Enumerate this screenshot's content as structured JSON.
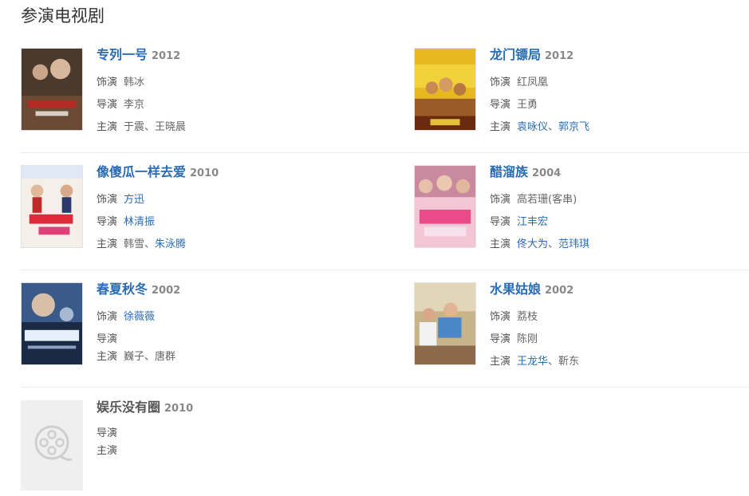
{
  "section_title": "参演电视剧",
  "labels": {
    "role": "饰演",
    "director": "导演",
    "cast": "主演",
    "sep": "、"
  },
  "colors": {
    "link": "#2a6cb4",
    "text": "#666666",
    "divider": "#ececec"
  },
  "shows": [
    {
      "title": "专列一号",
      "year": "2012",
      "role": "韩冰",
      "director": "李京",
      "cast": [
        "于震",
        "王晓晨"
      ],
      "poster_icon": "poster-image"
    },
    {
      "title": "龙门镖局",
      "year": "2012",
      "role": "红凤凰",
      "director": "王勇",
      "cast": [
        "袁咏仪",
        "郭京飞"
      ],
      "poster_icon": "poster-image"
    },
    {
      "title": "像傻瓜一样去爱",
      "year": "2010",
      "role": "方迅",
      "director": "林清振",
      "cast": [
        "韩雪",
        "朱泳腾"
      ],
      "poster_icon": "poster-image"
    },
    {
      "title": "醋溜族",
      "year": "2004",
      "role": "高若珊(客串)",
      "director": "江丰宏",
      "cast": [
        "佟大为",
        "范玮琪"
      ],
      "poster_icon": "poster-image"
    },
    {
      "title": "春夏秋冬",
      "year": "2002",
      "role": "徐薇薇",
      "director": "",
      "cast": [
        "巍子",
        "唐群"
      ],
      "poster_icon": "poster-image"
    },
    {
      "title": "水果姑娘",
      "year": "2002",
      "role": "荔枝",
      "director": "陈刚",
      "cast": [
        "王龙华",
        "靳东"
      ],
      "poster_icon": "poster-image"
    },
    {
      "title": "娱乐没有圈",
      "year": "2010",
      "director": "",
      "cast": [],
      "poster_icon": "film-reel-icon"
    }
  ]
}
